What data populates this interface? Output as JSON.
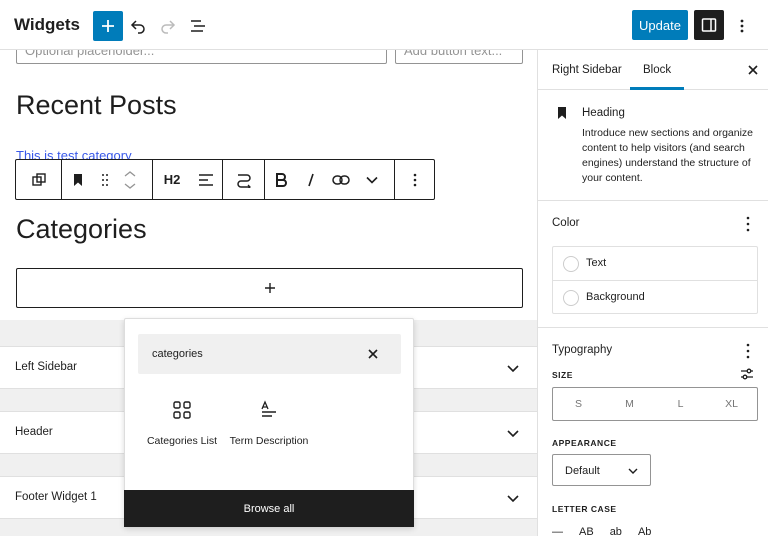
{
  "topbar": {
    "title": "Widgets",
    "icons": [
      "plus-icon",
      "undo-icon",
      "redo-icon",
      "list-view-icon"
    ],
    "update_label": "Update",
    "sidebar_toggle_icon": "sidebar-icon",
    "more_icon": "more-vertical-icon"
  },
  "canvas": {
    "search_placeholder": "Optional placeholder...",
    "button_placeholder": "Add button text...",
    "recent_posts_heading": "Recent Posts",
    "post_link": "This is test category",
    "categories_heading": "Categories",
    "block_toolbar": {
      "icons": [
        "transform-icon",
        "bookmark-icon",
        "drag-handle-icon",
        "move-up-icon",
        "move-down-icon",
        "heading-level",
        "align-icon",
        "link-chain-icon",
        "bold-icon",
        "italic-icon",
        "link-icon",
        "chevron-down-icon",
        "more-vertical-icon"
      ],
      "heading_level": "H2"
    },
    "appender_icon": "plus-icon",
    "areas": [
      {
        "label": "Left Sidebar"
      },
      {
        "label": "Header"
      },
      {
        "label": "Footer Widget 1"
      }
    ]
  },
  "inserter": {
    "search_value": "categories",
    "results": [
      {
        "label": "Categories List",
        "icon": "categories-list-icon"
      },
      {
        "label": "Term Description",
        "icon": "term-description-icon"
      }
    ],
    "browse_all_label": "Browse all"
  },
  "settings": {
    "tabs": [
      {
        "label": "Right Sidebar",
        "active": false
      },
      {
        "label": "Block",
        "active": true
      }
    ],
    "block": {
      "title": "Heading",
      "description": "Introduce new sections and organize content to help visitors (and search engines) understand the structure of your content."
    },
    "color": {
      "title": "Color",
      "items": [
        {
          "label": "Text"
        },
        {
          "label": "Background"
        }
      ]
    },
    "typography": {
      "title": "Typography",
      "size_label": "SIZE",
      "size_options": [
        "S",
        "M",
        "L",
        "XL"
      ],
      "appearance_label": "APPEARANCE",
      "appearance_value": "Default",
      "letter_case_label": "LETTER CASE",
      "letter_case_options": [
        "—",
        "AB",
        "ab",
        "Ab"
      ]
    }
  },
  "colors": {
    "accent": "#007cba",
    "dark": "#1e1e1e",
    "link": "#3858e9"
  }
}
